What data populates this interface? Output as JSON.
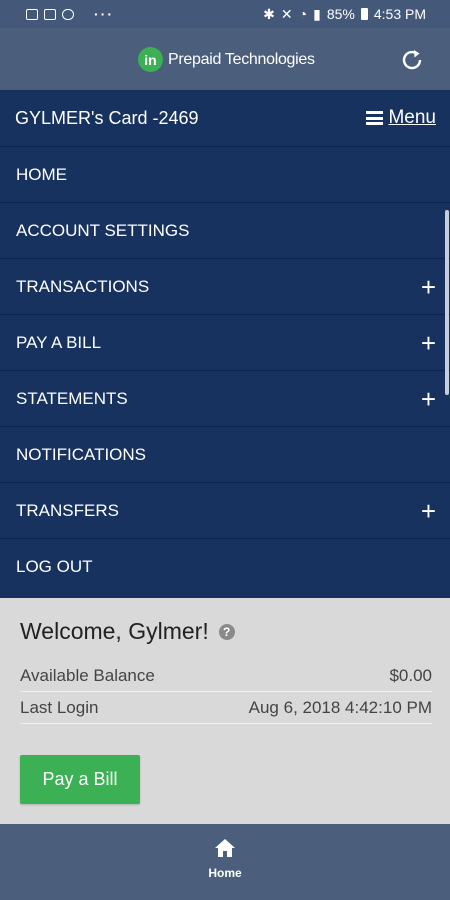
{
  "status_bar": {
    "battery": "85%",
    "time": "4:53 PM",
    "overflow": "···"
  },
  "header": {
    "logo_text": "in",
    "brand": "Prepaid Technologies"
  },
  "card_bar": {
    "title": "GYLMER's Card -2469",
    "menu_label": "Menu"
  },
  "nav": {
    "items": [
      {
        "label": "HOME",
        "expandable": false
      },
      {
        "label": "ACCOUNT SETTINGS",
        "expandable": false
      },
      {
        "label": "TRANSACTIONS",
        "expandable": true
      },
      {
        "label": "PAY A BILL",
        "expandable": true
      },
      {
        "label": "STATEMENTS",
        "expandable": true
      },
      {
        "label": "NOTIFICATIONS",
        "expandable": false
      },
      {
        "label": "TRANSFERS",
        "expandable": true
      },
      {
        "label": "LOG OUT",
        "expandable": false
      }
    ],
    "plus": "+"
  },
  "content": {
    "welcome": "Welcome, Gylmer!",
    "help": "?",
    "balance_label": "Available Balance",
    "balance_value": "$0.00",
    "login_label": "Last Login",
    "login_value": "Aug 6, 2018 4:42:10 PM",
    "pay_button": "Pay a Bill"
  },
  "tab_bar": {
    "home_label": "Home"
  },
  "colors": {
    "nav_bg": "#17325f",
    "header_bg": "#4b5f7c",
    "accent_green": "#3cb054"
  }
}
